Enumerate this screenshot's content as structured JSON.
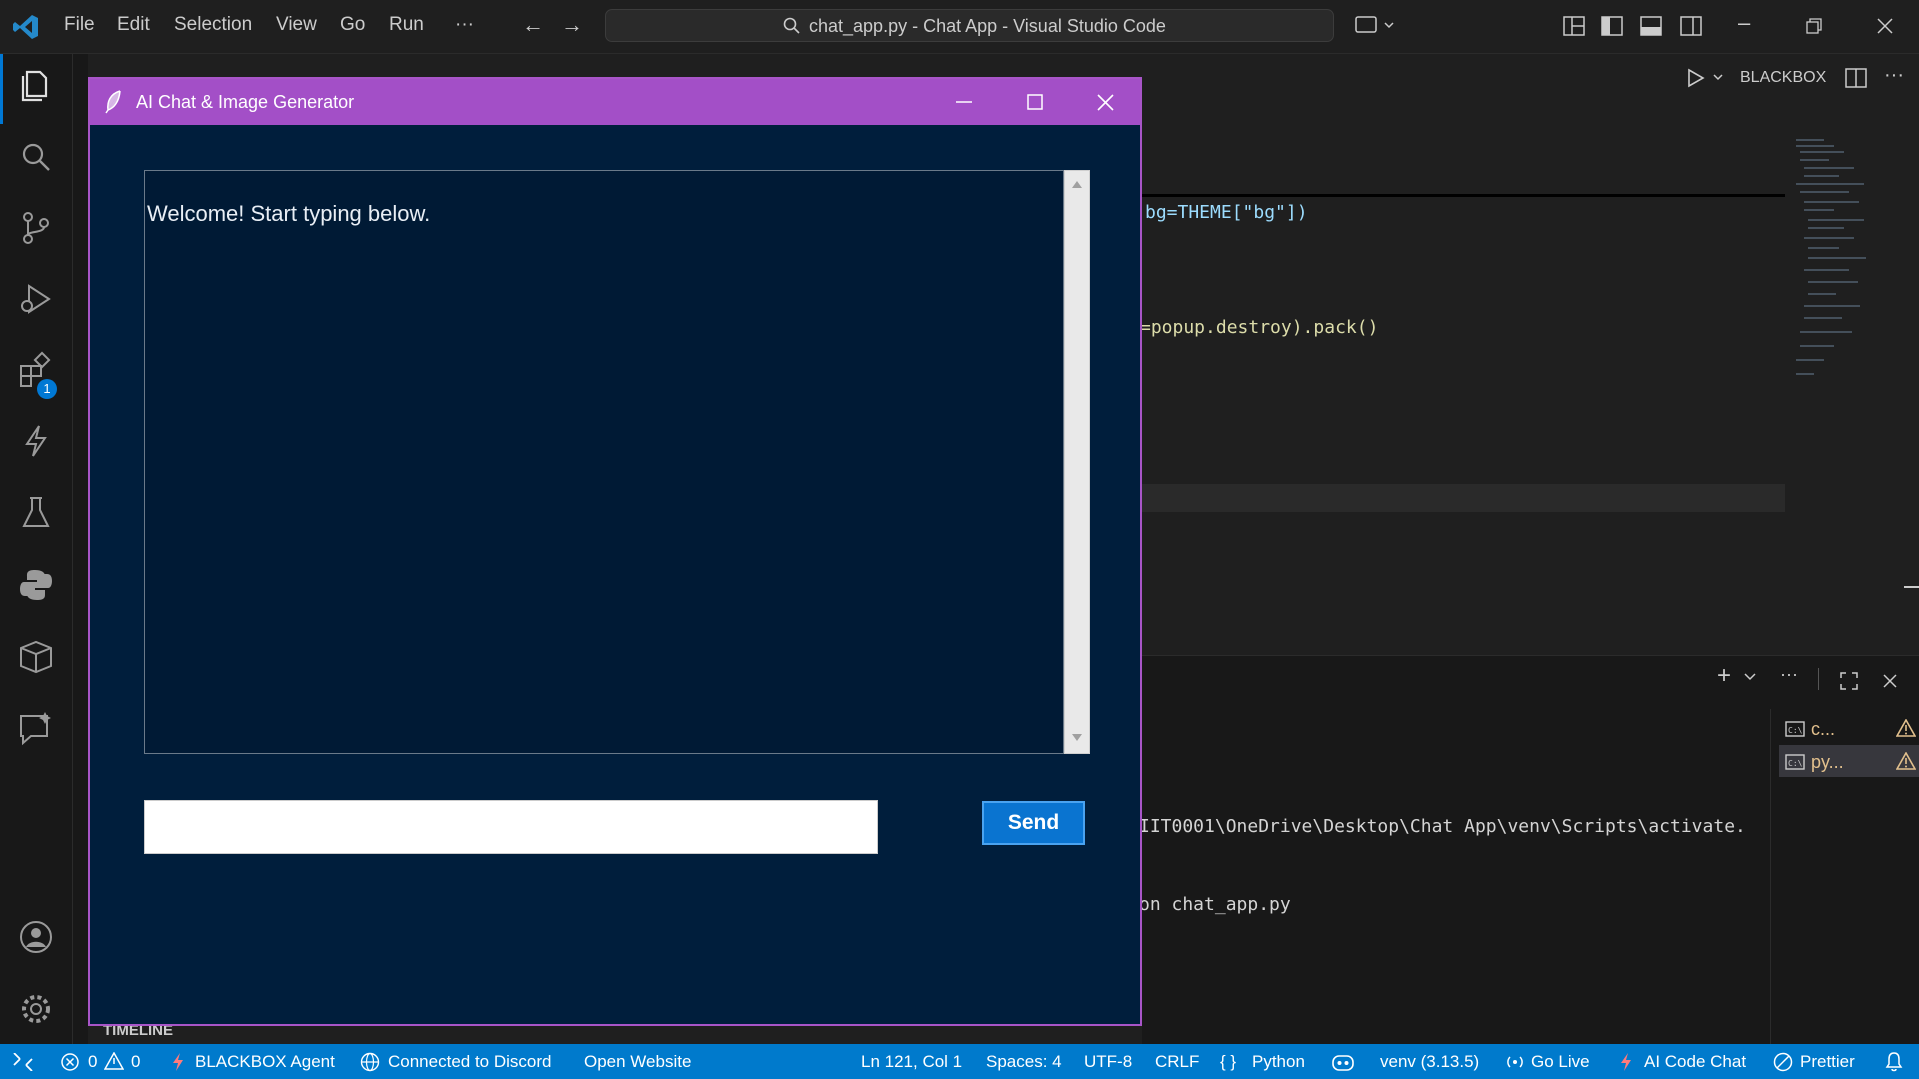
{
  "menu": [
    "File",
    "Edit",
    "Selection",
    "View",
    "Go",
    "Run",
    "···"
  ],
  "command_center": "chat_app.py - Chat App - Visual Studio Code",
  "editor": {
    "blackbox_label": "BLACKBOX",
    "line1": "bg=THEME[\"bg\"])",
    "line2": "=popup.destroy).pack()"
  },
  "terminal": {
    "line1": "IIT0001\\OneDrive\\Desktop\\Chat App\\venv\\Scripts\\activate.",
    "line2": "on chat_app.py",
    "tabs": [
      "c...",
      "py..."
    ]
  },
  "activity": {
    "extensions_badge": "1"
  },
  "sidebar": {
    "timeline": "TIMELINE"
  },
  "dialog": {
    "title": "AI Chat & Image Generator",
    "welcome": "Welcome! Start typing below.",
    "input_value": "",
    "send_label": "Send"
  },
  "status": {
    "errors": "0",
    "warnings": "0",
    "agent": "BLACKBOX Agent",
    "discord": "Connected to Discord",
    "website": "Open Website",
    "position": "Ln 121, Col 1",
    "spaces": "Spaces: 4",
    "encoding": "UTF-8",
    "eol": "CRLF",
    "language": "Python",
    "venv": "venv (3.13.5)",
    "golive": "Go Live",
    "codechat": "AI Code Chat",
    "prettier": "Prettier"
  },
  "colors": {
    "accent": "#a34fc7",
    "status": "#007acc",
    "dialog_bg": "#001e3c",
    "send": "#0a74d0"
  }
}
